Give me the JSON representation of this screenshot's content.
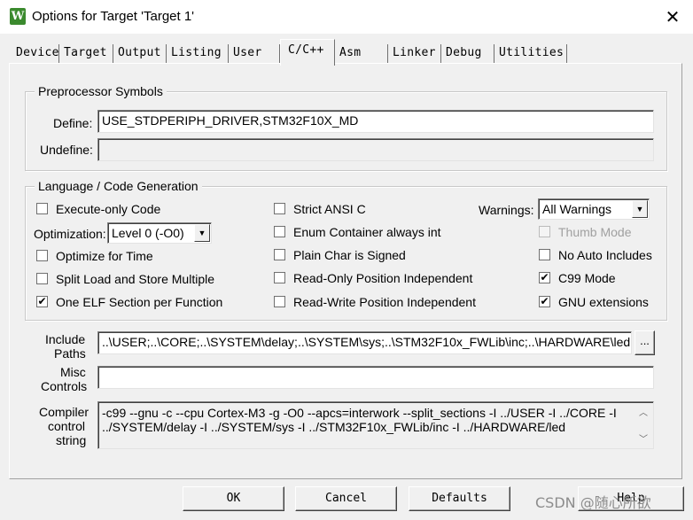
{
  "window": {
    "title": "Options for Target 'Target 1'",
    "app_icon_glyph": "W",
    "close_glyph": "✕"
  },
  "tabs": [
    "Device",
    "Target",
    "Output",
    "Listing",
    "User",
    "C/C++",
    "Asm",
    "Linker",
    "Debug",
    "Utilities"
  ],
  "active_tab": "C/C++",
  "preprocessor": {
    "group_label": "Preprocessor Symbols",
    "define_label": "Define:",
    "define_value": "USE_STDPERIPH_DRIVER,STM32F10X_MD",
    "undefine_label": "Undefine:",
    "undefine_value": ""
  },
  "language": {
    "group_label": "Language / Code Generation",
    "execute_only": {
      "label": "Execute-only Code",
      "checked": false
    },
    "optimization_label": "Optimization:",
    "optimization_value": "Level 0 (-O0)",
    "optimize_time": {
      "label": "Optimize for Time",
      "checked": false
    },
    "split_load": {
      "label": "Split Load and Store Multiple",
      "checked": false
    },
    "one_elf": {
      "label": "One ELF Section per Function",
      "checked": true
    },
    "strict_ansi": {
      "label": "Strict ANSI C",
      "checked": false
    },
    "enum_container": {
      "label": "Enum Container always int",
      "checked": false
    },
    "plain_char": {
      "label": "Plain Char is Signed",
      "checked": false
    },
    "ro_pi": {
      "label": "Read-Only Position Independent",
      "checked": false
    },
    "rw_pi": {
      "label": "Read-Write Position Independent",
      "checked": false
    },
    "warnings_label": "Warnings:",
    "warnings_value": "All Warnings",
    "thumb_mode": {
      "label": "Thumb Mode",
      "checked": false,
      "disabled": true
    },
    "no_auto_includes": {
      "label": "No Auto Includes",
      "checked": false
    },
    "c99_mode": {
      "label": "C99 Mode",
      "checked": true
    },
    "gnu_ext": {
      "label": "GNU extensions",
      "checked": true
    }
  },
  "paths": {
    "include_label_1": "Include",
    "include_label_2": "Paths",
    "include_value": "..\\USER;..\\CORE;..\\SYSTEM\\delay;..\\SYSTEM\\sys;..\\STM32F10x_FWLib\\inc;..\\HARDWARE\\led",
    "browse_label": "...",
    "misc_label_1": "Misc",
    "misc_label_2": "Controls",
    "misc_value": "",
    "compiler_label_1": "Compiler",
    "compiler_label_2": "control",
    "compiler_label_3": "string",
    "compiler_line_1": "-c99 --gnu -c --cpu Cortex-M3 -g -O0 --apcs=interwork --split_sections -I ../USER -I ../CORE -I",
    "compiler_line_2": "../SYSTEM/delay -I ../SYSTEM/sys -I ../STM32F10x_FWLib/inc -I ../HARDWARE/led"
  },
  "buttons": {
    "ok": "OK",
    "cancel": "Cancel",
    "defaults": "Defaults",
    "help": "Help"
  },
  "watermark": "CSDN @随心所欲"
}
